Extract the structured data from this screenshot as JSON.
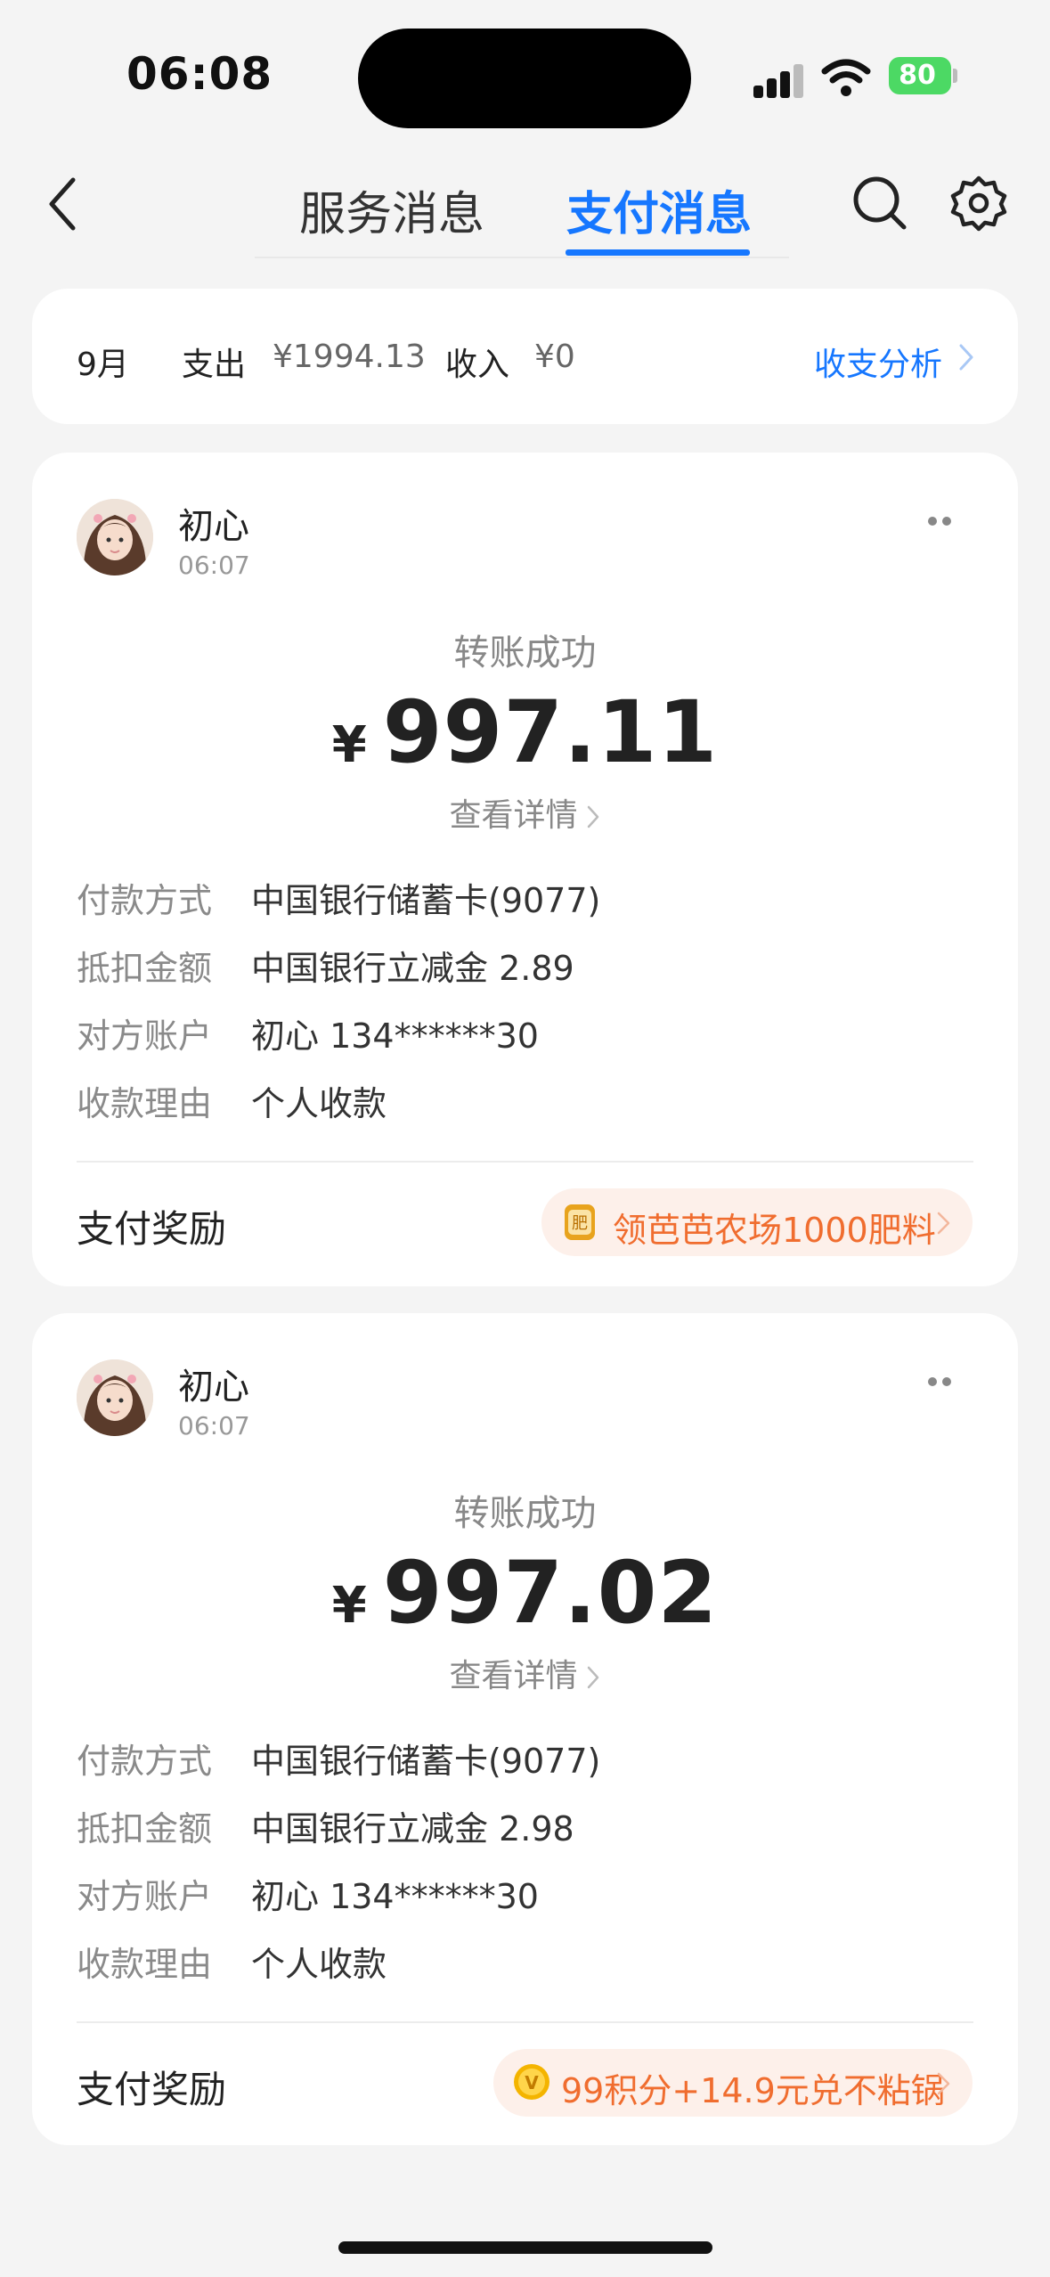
{
  "status_bar": {
    "time": "06:08",
    "battery": "80"
  },
  "nav": {
    "back_icon": "chevron-left-icon",
    "tabs": [
      {
        "label": "服务消息",
        "active": false
      },
      {
        "label": "支付消息",
        "active": true
      }
    ],
    "accent": "#1677ff"
  },
  "summary": {
    "month": "9月",
    "expense_label": "支出",
    "expense": "¥1994.13",
    "income_label": "收入",
    "income": "¥0",
    "analysis": "收支分析"
  },
  "cards": [
    {
      "name": "初心",
      "time": "06:07",
      "status": "转账成功",
      "currency": "¥",
      "amount": "997.11",
      "details": "查看详情",
      "rows": [
        {
          "k": "付款方式",
          "v": "中国银行储蓄卡(9077)"
        },
        {
          "k": "抵扣金额",
          "v": "中国银行立减金 2.89"
        },
        {
          "k": "对方账户",
          "v": "初心 134******30"
        },
        {
          "k": "收款理由",
          "v": "个人收款"
        }
      ],
      "reward_label": "支付奖励",
      "promo": "领芭芭农场1000肥料",
      "promo_icon": "fertilizer-icon",
      "promo_icon_text": "肥"
    },
    {
      "name": "初心",
      "time": "06:07",
      "status": "转账成功",
      "currency": "¥",
      "amount": "997.02",
      "details": "查看详情",
      "rows": [
        {
          "k": "付款方式",
          "v": "中国银行储蓄卡(9077)"
        },
        {
          "k": "抵扣金额",
          "v": "中国银行立减金 2.98"
        },
        {
          "k": "对方账户",
          "v": "初心 134******30"
        },
        {
          "k": "收款理由",
          "v": "个人收款"
        }
      ],
      "reward_label": "支付奖励",
      "promo": "99积分+14.9元兑不粘锅",
      "promo_icon": "points-icon",
      "promo_icon_text": "V"
    }
  ]
}
